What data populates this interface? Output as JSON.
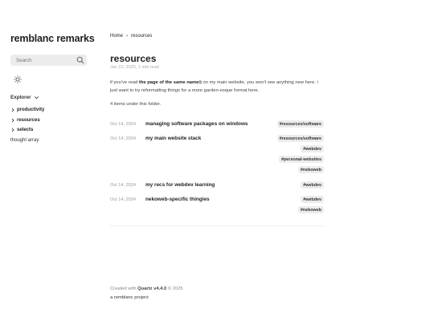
{
  "sidebar": {
    "site_title": "remblanc remarks",
    "search_placeholder": "Search",
    "explorer_label": "Explorer",
    "tree": [
      {
        "label": "productivity",
        "folder": true
      },
      {
        "label": "resources",
        "folder": true
      },
      {
        "label": "selects",
        "folder": true
      },
      {
        "label": "thought array",
        "folder": false
      }
    ]
  },
  "breadcrumb": {
    "home": "Home",
    "separator": "›",
    "current": "resources"
  },
  "page": {
    "title": "resources",
    "meta": "Jan 22, 2025, 1 min read",
    "intro_prefix": "if you've read ",
    "intro_link": "the page of the same name",
    "intro_suffix": " on my main website, you won't see anything new here. i just want to try reformatting things for a more garden-esque format here.",
    "count": "4 items under this folder."
  },
  "items": [
    {
      "date": "Oct 14, 2024",
      "title": "managing software packages on windows",
      "tags": [
        "#resources/software"
      ]
    },
    {
      "date": "Oct 14, 2024",
      "title": "my main website stack",
      "tags": [
        "#resources/software",
        "#webdev",
        "#personal-websites",
        "#nekoweb"
      ]
    },
    {
      "date": "Oct 14, 2024",
      "title": "my recs for webdev learning",
      "tags": [
        "#webdev"
      ]
    },
    {
      "date": "Oct 14, 2024",
      "title": "nekoweb-specific thingies",
      "tags": [
        "#webdev",
        "#nekoweb"
      ]
    }
  ],
  "footer": {
    "created_prefix": "Created with ",
    "created_link": "Quartz v4.4.0",
    "created_suffix": " © 2025",
    "project": "a remblanc project"
  }
}
